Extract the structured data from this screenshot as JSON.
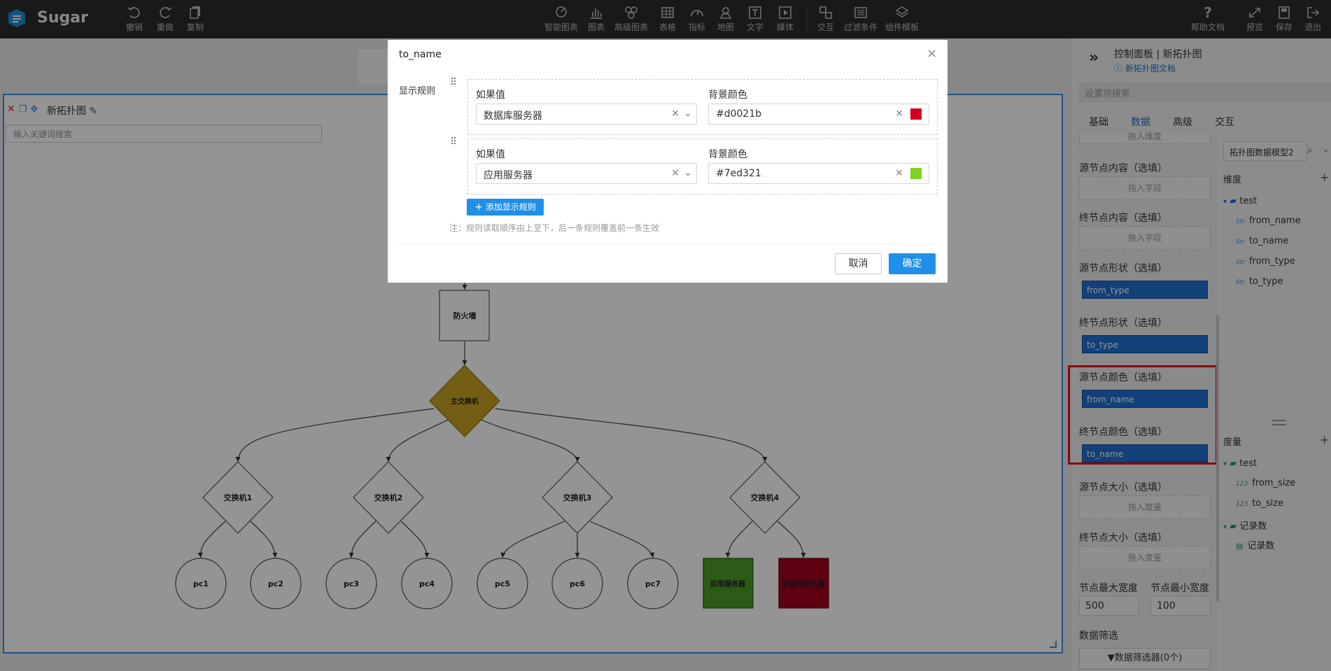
{
  "app": {
    "brand": "Sugar"
  },
  "toolbar_left": [
    {
      "label": "撤销",
      "icon": "undo-icon"
    },
    {
      "label": "重做",
      "icon": "redo-icon"
    },
    {
      "label": "复制",
      "icon": "copy-icon"
    }
  ],
  "toolbar_center": [
    {
      "label": "智能图表",
      "icon": "smart-chart-icon"
    },
    {
      "label": "图表",
      "icon": "bar-chart-icon"
    },
    {
      "label": "高级图表",
      "icon": "advanced-chart-icon"
    },
    {
      "label": "表格",
      "icon": "table-icon"
    },
    {
      "label": "指标",
      "icon": "gauge-icon"
    },
    {
      "label": "地图",
      "icon": "map-icon"
    },
    {
      "label": "文字",
      "icon": "text-icon"
    },
    {
      "label": "媒体",
      "icon": "media-icon"
    },
    {
      "label": "交互",
      "icon": "interaction-icon"
    },
    {
      "label": "过滤条件",
      "icon": "filter-icon"
    },
    {
      "label": "组件模板",
      "icon": "template-icon"
    }
  ],
  "toolbar_right": [
    {
      "label": "帮助文档",
      "icon": "help-icon"
    },
    {
      "label": "预览",
      "icon": "preview-icon"
    },
    {
      "label": "保存",
      "icon": "save-icon"
    },
    {
      "label": "退出",
      "icon": "exit-icon"
    }
  ],
  "board": {
    "title": "新拓扑图",
    "search_placeholder": "输入关键词搜索",
    "nodes": {
      "firewall": "防火墙",
      "core_switch": "主交换机",
      "switches": [
        "交换机1",
        "交换机2",
        "交换机3",
        "交换机4"
      ],
      "pcs": [
        "pc1",
        "pc2",
        "pc3",
        "pc4",
        "pc5",
        "pc6",
        "pc7"
      ],
      "app_server": "应用服务器",
      "db_server": "数据库服务器"
    },
    "colors": {
      "core": "#c9a227",
      "app": "#4a9a26",
      "db": "#a3001a"
    }
  },
  "modal": {
    "title": "to_name",
    "section_label": "显示规则",
    "rules": [
      {
        "if_label": "如果值",
        "value": "数据库服务器",
        "color_label": "背景颜色",
        "color": "#d0021b"
      },
      {
        "if_label": "如果值",
        "value": "应用服务器",
        "color_label": "背景颜色",
        "color": "#7ed321"
      }
    ],
    "add_rule": "添加显示规则",
    "note": "注：规则读取顺序由上至下，后一条规则覆盖前一条生效",
    "cancel": "取消",
    "ok": "确定"
  },
  "panel": {
    "breadcrumb": "控制面板 | 新拓扑图",
    "doc_link": "新拓扑图文档",
    "search_placeholder": "设置项搜索",
    "tabs": [
      "基础",
      "数据",
      "高级",
      "交互"
    ],
    "active_tab": "数据",
    "partial_drop": "拖入维度",
    "sections": [
      {
        "label": "源节点内容（选填）",
        "drop": "拖入字段"
      },
      {
        "label": "终节点内容（选填）",
        "drop": "拖入字段"
      },
      {
        "label": "源节点形状（选填）",
        "field": "from_type"
      },
      {
        "label": "终节点形状（选填）",
        "field": "to_type"
      },
      {
        "label": "源节点颜色（选填）",
        "field": "from_name"
      },
      {
        "label": "终节点颜色（选填）",
        "field": "to_name"
      },
      {
        "label": "源节点大小（选填）",
        "drop": "拖入度量"
      },
      {
        "label": "终节点大小（选填）",
        "drop": "拖入度量"
      }
    ],
    "max_width_label": "节点最大宽度",
    "min_width_label": "节点最小宽度",
    "max_width": "500",
    "min_width": "100",
    "filter_label": "数据筛选",
    "filter_button": "数据筛选器(0个)",
    "model_select": "拓扑图数据模型2",
    "dimensions_label": "维度",
    "dimension_group": "test",
    "dimensions": [
      "from_name",
      "to_name",
      "from_type",
      "to_type"
    ],
    "measures_label": "度量",
    "measure_group": "test",
    "measures": [
      "from_size",
      "to_size"
    ],
    "record_group": "记录数",
    "record_item": "记录数",
    "type_str": "Str",
    "type_num": "123"
  }
}
